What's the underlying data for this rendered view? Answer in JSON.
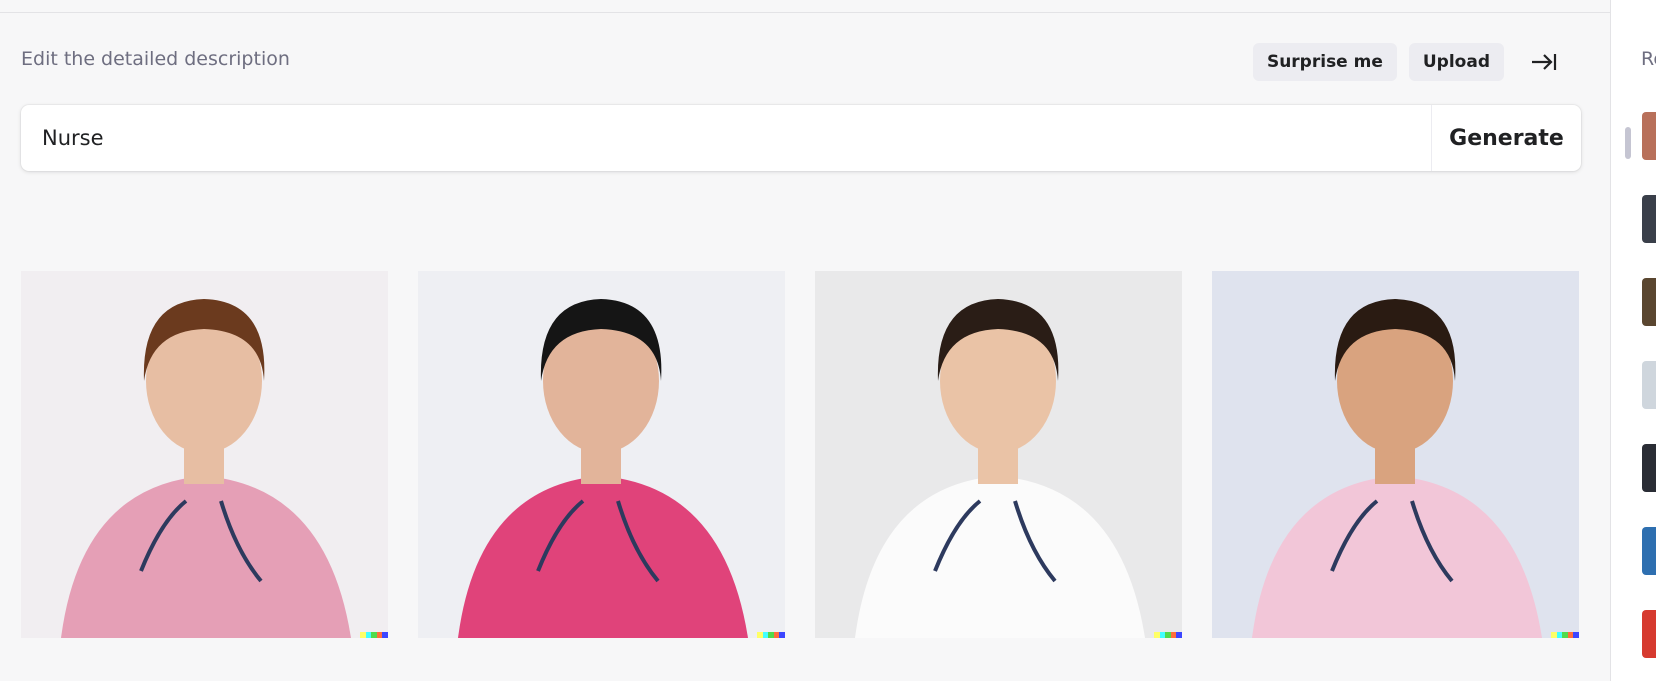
{
  "header": {
    "label": "Edit the detailed description",
    "surprise_label": "Surprise me",
    "upload_label": "Upload"
  },
  "prompt": {
    "value": "Nurse",
    "generate_label": "Generate"
  },
  "results": [
    {
      "name": "nurse-image-1",
      "bg": "#f1eef1",
      "scrubs": "#e59fb6",
      "hair": "#6b3a1e",
      "skin": "#e7bea3"
    },
    {
      "name": "nurse-image-2",
      "bg": "#eeeff3",
      "scrubs": "#e0437a",
      "hair": "#151515",
      "skin": "#e2b49a"
    },
    {
      "name": "nurse-image-3",
      "bg": "#e9e9ea",
      "scrubs": "#fbfbfb",
      "hair": "#2a1d16",
      "skin": "#eac3a6"
    },
    {
      "name": "nurse-image-4",
      "bg": "#dfe3ee",
      "scrubs": "#f2c6d8",
      "hair": "#2a1b12",
      "skin": "#d9a37f"
    }
  ],
  "signature_colors": [
    "#ffff66",
    "#42ffff",
    "#51da4c",
    "#ff6e3c",
    "#3c46ff"
  ],
  "sidebar": {
    "title": "Recent",
    "thumb_colors": [
      "#b8705a",
      "#3a3f4a",
      "#5a4630",
      "#cfd6dd",
      "#2a2d35",
      "#2e6fb0",
      "#d63a2f"
    ]
  }
}
